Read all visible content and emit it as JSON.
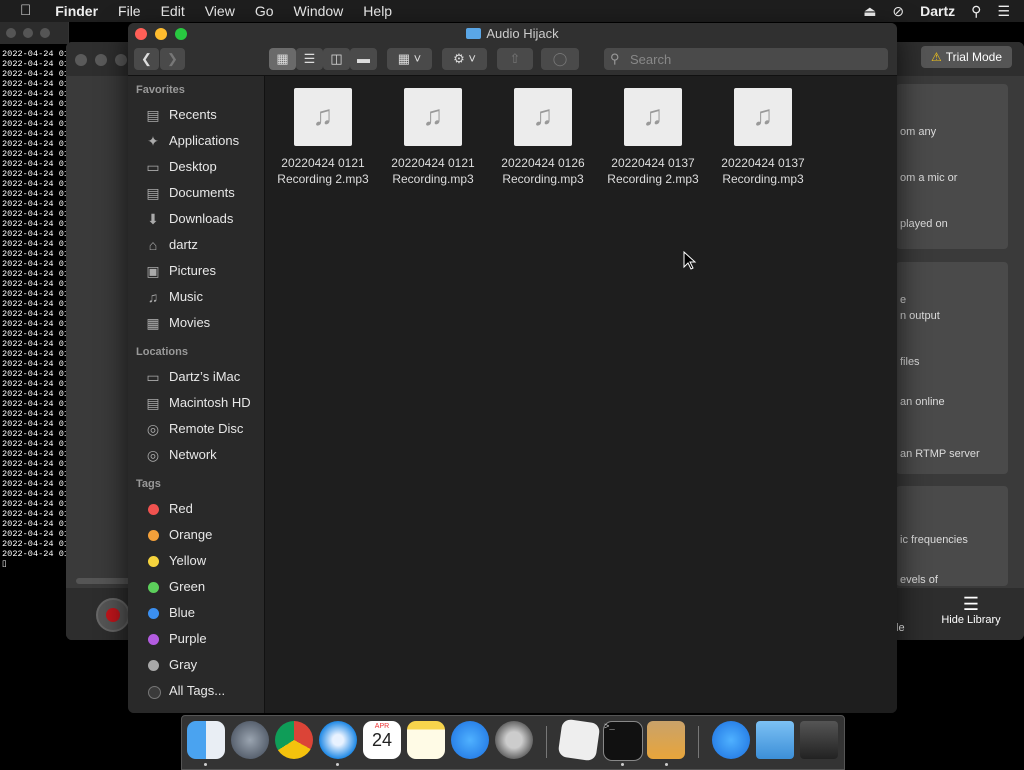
{
  "menubar": {
    "apple": "",
    "app": "Finder",
    "items": [
      "File",
      "Edit",
      "View",
      "Go",
      "Window",
      "Help"
    ],
    "user": "Dartz",
    "eject_icon": "eject-icon",
    "colorsync_icon": "no-sign-icon",
    "search_icon": "search-icon",
    "list_icon": "menu-list-icon"
  },
  "terminal": {
    "line_text": "2022-04-24 01",
    "line_count": 51,
    "prompt": "▯"
  },
  "audio_hijack": {
    "trial_label": "Trial Mode",
    "panel_texts": [
      "om any",
      "om a mic or",
      "played on",
      "e",
      "n output",
      "files",
      "an online",
      "an RTMP server",
      "ic frequencies",
      "evels of"
    ],
    "bottom_partial": "le",
    "hide_library": "Hide Library"
  },
  "finder": {
    "title": "Audio Hijack",
    "search_placeholder": "Search",
    "sidebar": {
      "favorites_header": "Favorites",
      "favorites": [
        {
          "label": "Recents",
          "icon": "recents-icon"
        },
        {
          "label": "Applications",
          "icon": "applications-icon"
        },
        {
          "label": "Desktop",
          "icon": "desktop-icon"
        },
        {
          "label": "Documents",
          "icon": "documents-icon"
        },
        {
          "label": "Downloads",
          "icon": "downloads-icon"
        },
        {
          "label": "dartz",
          "icon": "home-icon"
        },
        {
          "label": "Pictures",
          "icon": "pictures-icon"
        },
        {
          "label": "Music",
          "icon": "music-icon"
        },
        {
          "label": "Movies",
          "icon": "movies-icon"
        }
      ],
      "locations_header": "Locations",
      "locations": [
        {
          "label": "Dartz’s iMac",
          "icon": "imac-icon"
        },
        {
          "label": "Macintosh HD",
          "icon": "disk-icon"
        },
        {
          "label": "Remote Disc",
          "icon": "remote-disc-icon"
        },
        {
          "label": "Network",
          "icon": "network-icon"
        }
      ],
      "tags_header": "Tags",
      "tags": [
        {
          "label": "Red",
          "color": "#f0524f"
        },
        {
          "label": "Orange",
          "color": "#f3a03a"
        },
        {
          "label": "Yellow",
          "color": "#f5d33d"
        },
        {
          "label": "Green",
          "color": "#5ccf5b"
        },
        {
          "label": "Blue",
          "color": "#3b8ff0"
        },
        {
          "label": "Purple",
          "color": "#b35ce0"
        },
        {
          "label": "Gray",
          "color": "#a8a8a8"
        },
        {
          "label": "All Tags...",
          "color": "#3a3a3a"
        }
      ]
    },
    "files": [
      {
        "line1": "20220424 0121",
        "line2": "Recording 2.mp3"
      },
      {
        "line1": "20220424 0121",
        "line2": "Recording.mp3"
      },
      {
        "line1": "20220424 0126",
        "line2": "Recording.mp3"
      },
      {
        "line1": "20220424 0137",
        "line2": "Recording 2.mp3"
      },
      {
        "line1": "20220424 0137",
        "line2": "Recording.mp3"
      }
    ]
  },
  "dock": {
    "calendar_month": "APR",
    "calendar_day": "24",
    "apps": [
      "finder-icon",
      "launchpad-icon",
      "chrome-icon",
      "safari-icon",
      "calendar-icon",
      "notes-icon",
      "app-store-icon",
      "system-preferences-icon",
      "textedit-icon",
      "terminal-icon",
      "audio-hijack-icon",
      "app-store-downloads-icon",
      "folder-icon",
      "trash-icon"
    ]
  }
}
